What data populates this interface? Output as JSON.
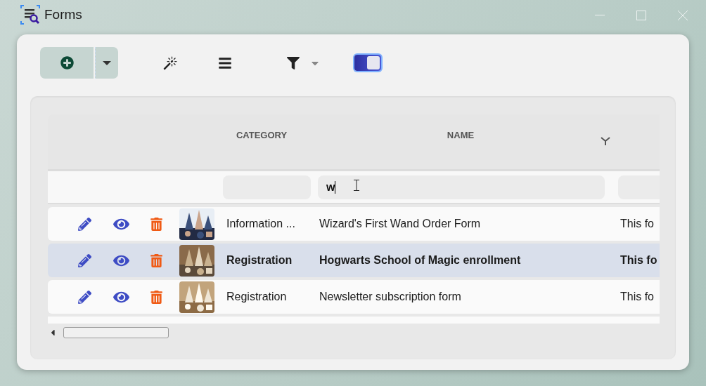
{
  "window": {
    "title": "Forms"
  },
  "toolbar": {
    "view_toggle": {
      "on": true
    }
  },
  "table": {
    "columns": [
      {
        "label": "CATEGORY"
      },
      {
        "label": "NAME"
      }
    ],
    "filters": {
      "name_value": "w"
    },
    "rows": [
      {
        "category": "Information ...",
        "name": "Wizard's First Wand Order Form",
        "column_3": "This fo",
        "selected": false
      },
      {
        "category": "Registration",
        "name": "Hogwarts School of Magic enrollment",
        "column_3": "This fo",
        "selected": true
      },
      {
        "category": "Registration",
        "name": "Newsletter subscription form",
        "column_3": "This fo",
        "selected": false
      }
    ]
  }
}
